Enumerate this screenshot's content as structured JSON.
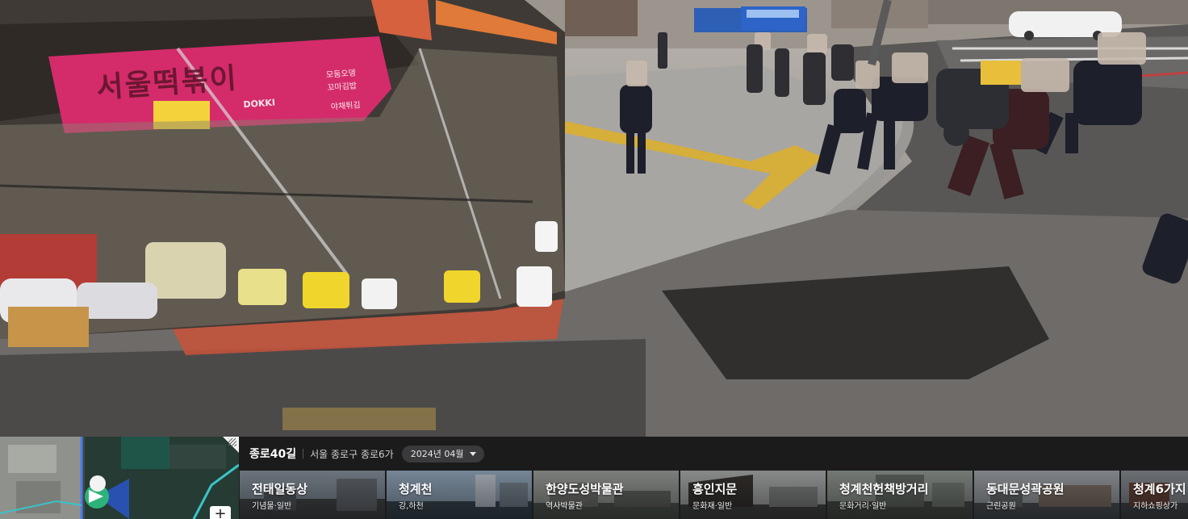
{
  "shop_sign": {
    "line1": "서울떡볶이",
    "line2": "DOKKI",
    "menu": [
      "모둠오뎅",
      "꼬마김밥",
      "야채튀김"
    ]
  },
  "location": {
    "name": "종로40길",
    "address": "서울 종로구 종로6가",
    "date": "2024년 04월"
  },
  "nearby": [
    {
      "title": "전태일동상",
      "category": "기념물·일반"
    },
    {
      "title": "청계천",
      "category": "강,하천"
    },
    {
      "title": "한양도성박물관",
      "category": "역사박물관"
    },
    {
      "title": "흥인지문",
      "category": "문화재·일반"
    },
    {
      "title": "청계천헌책방거리",
      "category": "문화거리·일반"
    },
    {
      "title": "동대문성곽공원",
      "category": "근린공원"
    },
    {
      "title": "청계6가지",
      "category": "지하쇼핑상가"
    }
  ],
  "minimap": {
    "zoom_in_label": "+"
  },
  "colors": {
    "bar_bg": "#1b1b1c",
    "date_pill": "#3a3a3c",
    "marker_green": "#2db37a",
    "marker_blue": "#2b59d9"
  }
}
